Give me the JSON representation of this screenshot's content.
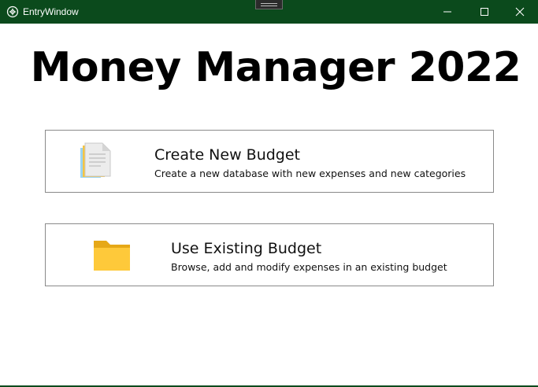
{
  "window": {
    "title": "EntryWindow",
    "titlebar_color": "#0b4a1c",
    "controls": {
      "minimize_icon": "minimize-icon",
      "maximize_icon": "maximize-icon",
      "close_icon": "close-icon"
    }
  },
  "main": {
    "title": "Money Manager 2022",
    "options": [
      {
        "icon": "document-icon",
        "title": "Create New Budget",
        "description": "Create a new database with new expenses and new categories"
      },
      {
        "icon": "folder-icon",
        "title": "Use Existing Budget",
        "description": "Browse, add and modify expenses in an existing budget"
      }
    ]
  },
  "colors": {
    "folder": "#f8c23a",
    "card_border": "#8a8a8a"
  }
}
